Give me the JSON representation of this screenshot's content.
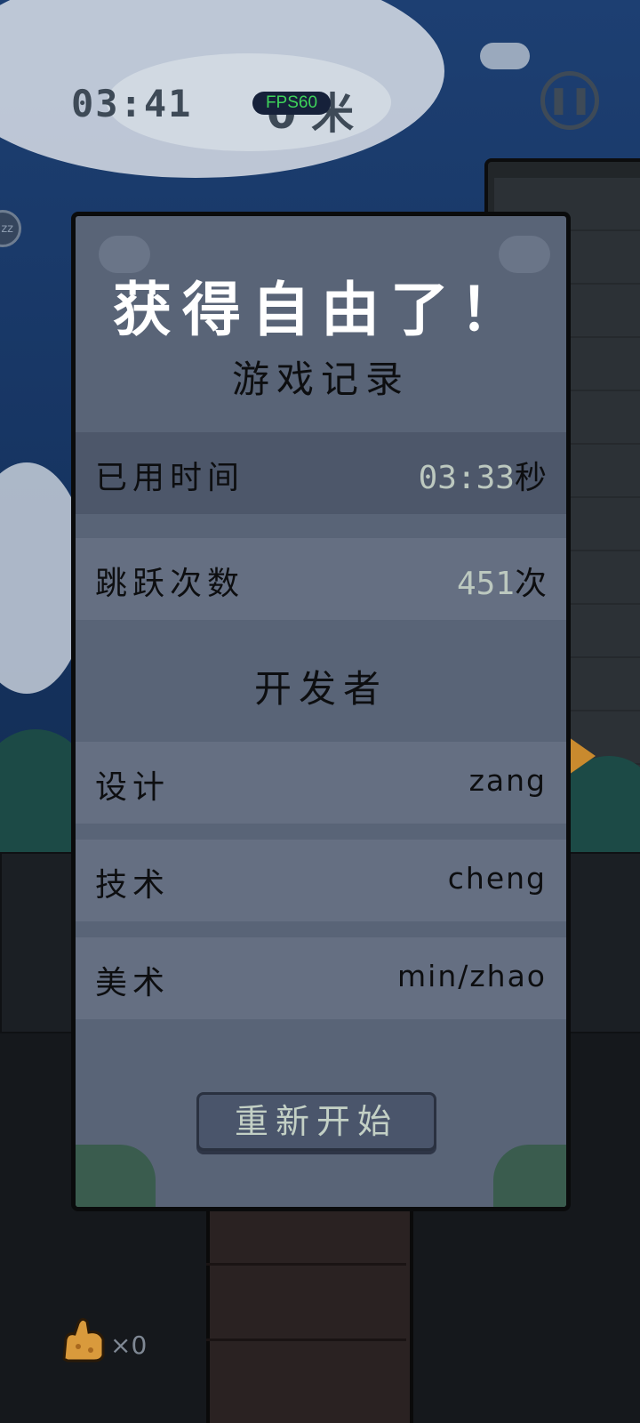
{
  "hud": {
    "timer": "03:41",
    "distance": "0 米",
    "fps": "FPS60",
    "sleep_badge": "zz",
    "item_count": "×0"
  },
  "result": {
    "title": "获得自由了！",
    "record_heading": "游戏记录",
    "stats": [
      {
        "label": "已用时间",
        "value": "03:33",
        "unit": "秒"
      },
      {
        "label": "跳跃次数",
        "value": "451",
        "unit": "次"
      }
    ],
    "developers_heading": "开发者",
    "credits": [
      {
        "role": "设计",
        "name": "zang"
      },
      {
        "role": "技术",
        "name": "cheng"
      },
      {
        "role": "美术",
        "name": "min/zhao"
      }
    ],
    "restart_label": "重新开始"
  },
  "colors": {
    "panel": "#596477",
    "value_highlight": "#bcc8bf",
    "fps_text": "#3ed35a"
  },
  "icons": [
    "pause-icon",
    "sleep-icon",
    "bread-icon"
  ]
}
